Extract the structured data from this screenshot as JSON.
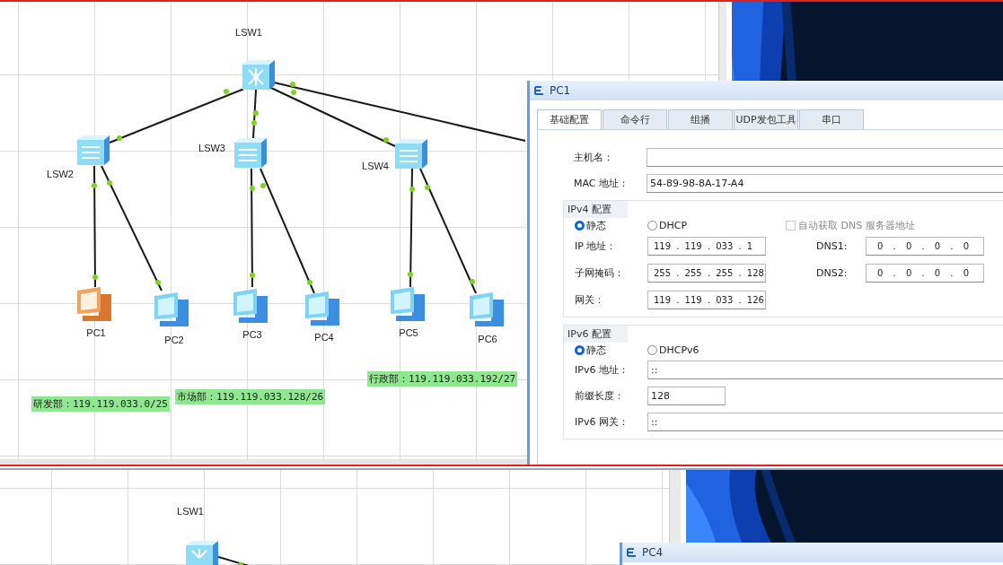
{
  "top": {
    "canvas": {
      "devices": [
        {
          "name": "LSW1",
          "kind": "core_switch",
          "selected": false
        },
        {
          "name": "LSW2",
          "kind": "switch",
          "selected": false
        },
        {
          "name": "LSW3",
          "kind": "switch",
          "selected": false
        },
        {
          "name": "LSW4",
          "kind": "switch",
          "selected": false
        },
        {
          "name": "PC1",
          "kind": "pc",
          "selected": true
        },
        {
          "name": "PC2",
          "kind": "pc",
          "selected": false
        },
        {
          "name": "PC3",
          "kind": "pc",
          "selected": false
        },
        {
          "name": "PC4",
          "kind": "pc",
          "selected": false
        },
        {
          "name": "PC5",
          "kind": "pc",
          "selected": false
        },
        {
          "name": "PC6",
          "kind": "pc",
          "selected": false
        }
      ],
      "subnets": [
        {
          "text": "研发部：119.119.033.0/25"
        },
        {
          "text": "市场部：119.119.033.128/26"
        },
        {
          "text": "行政部：119.119.033.192/27"
        }
      ]
    },
    "dialog": {
      "title": "PC1",
      "tabs": [
        {
          "label": "基础配置",
          "selected": true
        },
        {
          "label": "命令行",
          "selected": false
        },
        {
          "label": "组播",
          "selected": false
        },
        {
          "label": "UDP发包工具",
          "selected": false
        },
        {
          "label": "串口",
          "selected": false
        }
      ],
      "host_name": {
        "label": "主机名："
      },
      "mac": {
        "label": "MAC 地址：",
        "value": "54-89-98-8A-17-A4"
      },
      "ipv4": {
        "title": "IPv4 配置",
        "modes": [
          {
            "label": "静态",
            "selected": true
          },
          {
            "label": "DHCP",
            "selected": false
          }
        ],
        "auto_dns": {
          "label": "自动获取 DNS 服务器地址",
          "checked": false,
          "disabled": true
        },
        "fields": [
          {
            "label": "IP 地址：",
            "value": "119 . 119 . 033 . 1"
          },
          {
            "label": "子网掩码：",
            "value": "255 . 255 . 255 . 128"
          },
          {
            "label": "网关：",
            "value": "119 . 119 . 033 . 126"
          }
        ],
        "dns": [
          {
            "label": "DNS1:",
            "value": "0 . 0 . 0 . 0"
          },
          {
            "label": "DNS2:",
            "value": "0 . 0 . 0 . 0"
          }
        ]
      },
      "ipv6": {
        "title": "IPv6 配置",
        "modes": [
          {
            "label": "静态",
            "selected": true
          },
          {
            "label": "DHCPv6",
            "selected": false
          }
        ],
        "fields": [
          {
            "label": "IPv6 地址：",
            "value": "::",
            "kind": "wide"
          },
          {
            "label": "前缀长度：",
            "value": "128",
            "kind": "short"
          },
          {
            "label": "IPv6 网关：",
            "value": "::",
            "kind": "wide"
          }
        ]
      }
    }
  },
  "bottom": {
    "canvas": {
      "devices": [
        {
          "name": "LSW1",
          "kind": "core_switch",
          "selected": false
        }
      ]
    },
    "dialog": {
      "title": "PC4"
    }
  }
}
